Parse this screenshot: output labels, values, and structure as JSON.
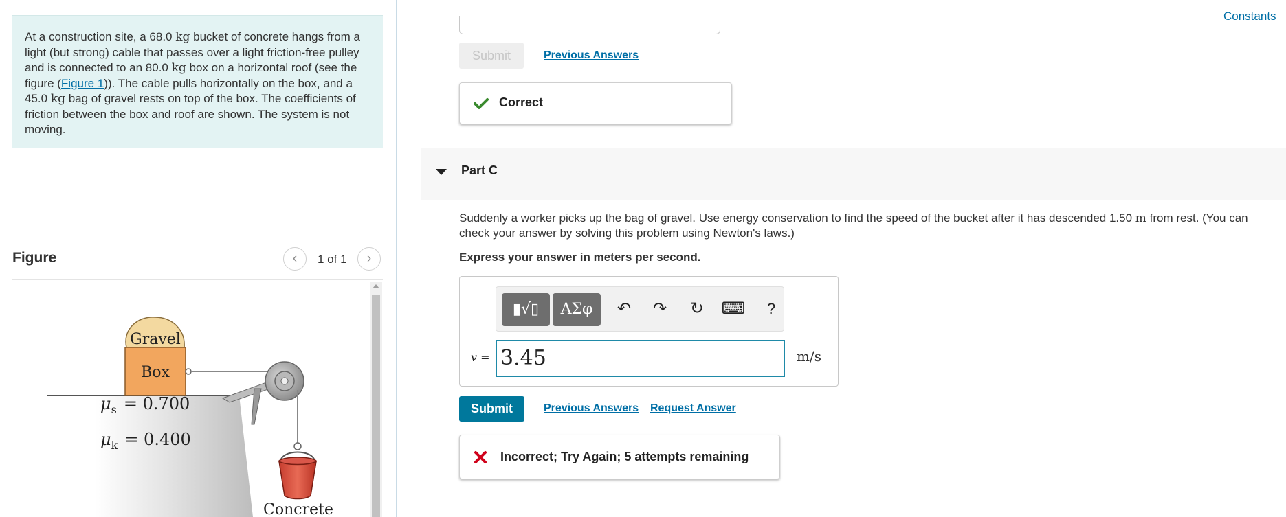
{
  "problem": {
    "t1": "At a construction site, a 68.0 ",
    "u1": "kg",
    "t2": " bucket of concrete hangs from a light (but strong) cable that passes over a light friction-free pulley and is connected to an 80.0 ",
    "u2": "kg",
    "t3": " box on a horizontal roof (see the figure (",
    "figure_link": "Figure 1",
    "t4": ")). The cable pulls horizontally on the box, and a 45.0 ",
    "u3": "kg",
    "t5": " bag of gravel rests on top of the box. The coefficients of friction between the box and roof are shown. The system is not moving."
  },
  "figure": {
    "title": "Figure",
    "counter": "1 of 1",
    "prev_icon": "‹",
    "next_icon": "›",
    "labels": {
      "gravel": "Gravel",
      "box": "Box",
      "mu_s_symbol": "μ",
      "mu_s_sub": "s",
      "mu_s_value": "= 0.700",
      "mu_k_symbol": "μ",
      "mu_k_sub": "k",
      "mu_k_value": "= 0.400",
      "concrete": "Concrete"
    }
  },
  "header": {
    "constants_link": "Constants"
  },
  "previous_part": {
    "submit_label": "Submit",
    "previous_answers": "Previous Answers",
    "feedback": "Correct",
    "feedback_color": "#3a8a2e"
  },
  "part_c": {
    "title": "Part C",
    "q1": "Suddenly a worker picks up the bag of gravel. Use energy conservation to find the speed of the bucket after it has descended 1.50 ",
    "q_unit": "m",
    "q2": " from rest. (You can check your answer by solving this problem using Newton's laws.)",
    "instruction": "Express your answer in meters per second.",
    "toolbar": {
      "template_icon": "▮√▯",
      "greek_label": "ΑΣφ",
      "undo_icon": "↶",
      "redo_icon": "↷",
      "reset_icon": "↻",
      "keyboard_icon": "⌨",
      "help_label": "?"
    },
    "variable": "v",
    "equals": " =",
    "answer_value": "3.45",
    "unit": "m/s",
    "submit_label": "Submit",
    "previous_answers": "Previous Answers",
    "request_answer": "Request Answer",
    "feedback": "Incorrect; Try Again; 5 attempts remaining",
    "feedback_color": "#d0021b",
    "accent_color": "#00789c"
  }
}
